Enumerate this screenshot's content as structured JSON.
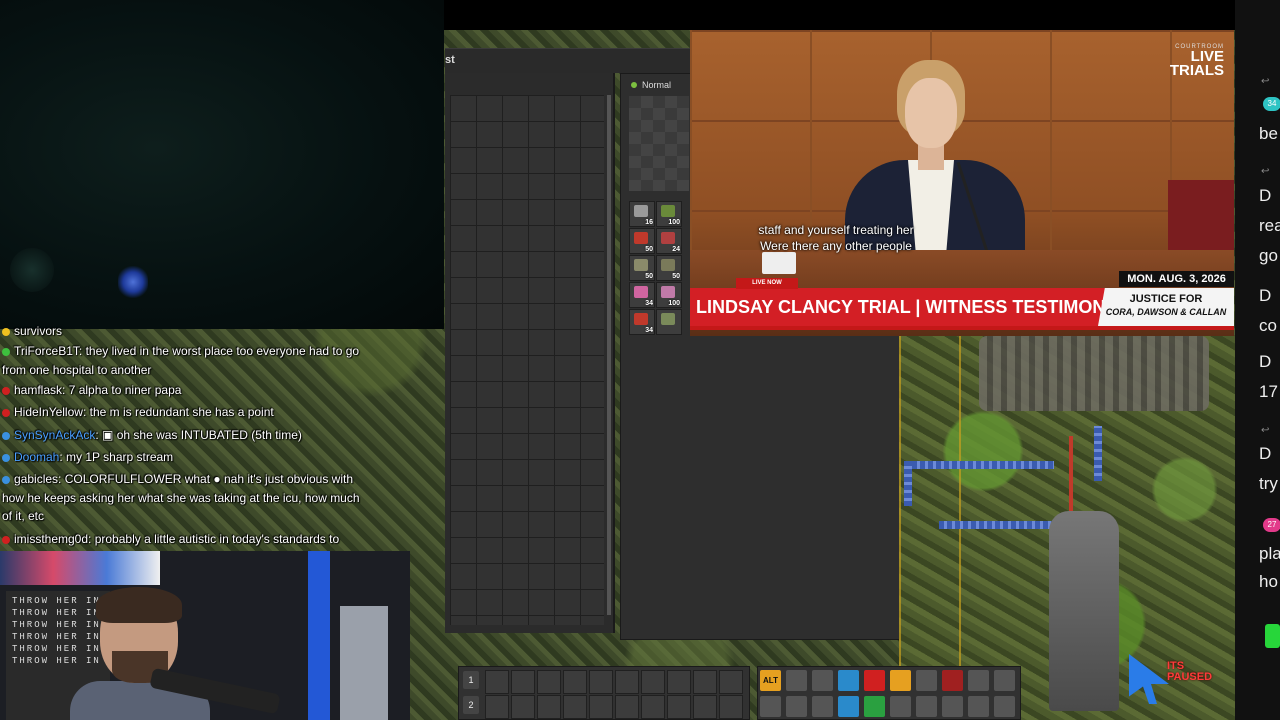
{
  "inventory": {
    "title_fragment": "st"
  },
  "normal_panel": {
    "label": "Normal"
  },
  "items": [
    {
      "qty": "16",
      "color": "#9a9a9a"
    },
    {
      "qty": "100",
      "color": "#6a8a3a"
    },
    {
      "qty": "50",
      "color": "#c0392b"
    },
    {
      "qty": "24",
      "color": "#b04040"
    },
    {
      "qty": "50",
      "color": "#8a8a6a"
    },
    {
      "qty": "50",
      "color": "#7a7a5a"
    },
    {
      "qty": "34",
      "color": "#d065a0"
    },
    {
      "qty": "100",
      "color": "#c07aa8"
    },
    {
      "qty": "34",
      "color": "#c0392b"
    },
    {
      "qty": "",
      "color": "#7a8a5a"
    }
  ],
  "news": {
    "logo_small": "COURTROOM",
    "logo_line1": "LIVE",
    "logo_line2": "TRIALS",
    "subtitle_line1": "staff and yourself treating her",
    "subtitle_line2": "Were there any other people",
    "live_now": "LIVE NOW",
    "banner": "LINDSAY CLANCY TRIAL | WITNESS TESTIMONY",
    "date": "MON. AUG. 3, 2026",
    "justice_line1": "JUSTICE FOR",
    "justice_line2": "CORA, DAWSON & CALLAN"
  },
  "chat": [
    {
      "badge_color": "#f0c020",
      "user": "",
      "user_color": "#ffffff",
      "text": "survivors"
    },
    {
      "badge_color": "#3ec03e",
      "user": "TriForceB1T",
      "user_color": "#ffffff",
      "text": ": they lived in the worst place too everyone had to go"
    },
    {
      "badge_color": "",
      "user": "",
      "user_color": "#ffffff",
      "text": "from one hospital to another"
    },
    {
      "badge_color": "#d02020",
      "user": "hamflask",
      "user_color": "#ffffff",
      "text": ": 7 alpha to niner papa"
    },
    {
      "badge_color": "#d02020",
      "user": "HideInYellow",
      "user_color": "#ffffff",
      "text": ": the m is redundant she has a point"
    },
    {
      "badge_color": "#3a90e0",
      "user": "SynSynAckAck",
      "user_color": "#4a9fff",
      "text": ": ▣ oh she was INTUBATED (5th time)"
    },
    {
      "badge_color": "#3a90e0",
      "user": "Doomah",
      "user_color": "#4a9fff",
      "text": ": my 1P sharp stream"
    },
    {
      "badge_color": "#3a90e0",
      "user": "gabicles",
      "user_color": "#ffffff",
      "text": ": COLORFULFLOWER what ● nah it's just obvious with"
    },
    {
      "badge_color": "",
      "user": "",
      "user_color": "#ffffff",
      "text": "how he keeps asking her what she was taking at the icu, how much"
    },
    {
      "badge_color": "",
      "user": "",
      "user_color": "#ffffff",
      "text": "of it, etc"
    },
    {
      "badge_color": "#d02020",
      "user": "imissthemg0d",
      "user_color": "#ffffff",
      "text": ": probably a little autistic in today's standards to"
    }
  ],
  "poster": {
    "lines": "THROW HER IN\nTHROW HER IN\nTHROW HER IN\nTHROW HER IN\nTHROW HER IN\nTHROW HER IN"
  },
  "hotbar": {
    "row1": "1",
    "row2": "2"
  },
  "toolbar": {
    "alt": "ALT"
  },
  "game": {
    "paused_line1": "ITS",
    "paused_line2": "PAUSED"
  },
  "right_chat": {
    "pill1": "34",
    "pill2": "27",
    "fragments": [
      "be",
      "D",
      "rea",
      "go",
      "D",
      "co",
      "D",
      "17",
      "D",
      "try",
      "pla",
      "ho"
    ]
  }
}
